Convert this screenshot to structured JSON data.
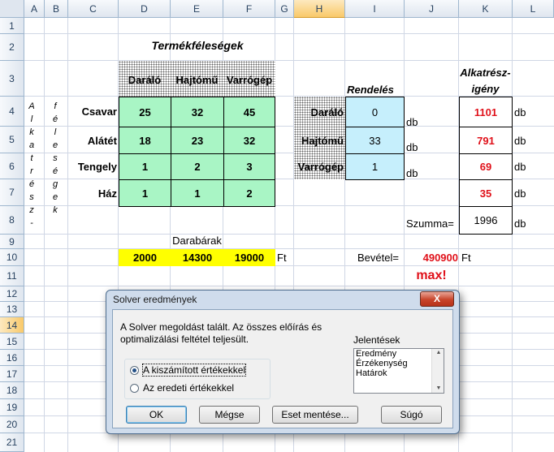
{
  "columns": [
    "A",
    "B",
    "C",
    "D",
    "E",
    "F",
    "G",
    "H",
    "I",
    "J",
    "K",
    "L"
  ],
  "rows": [
    "1",
    "2",
    "3",
    "4",
    "5",
    "6",
    "7",
    "8",
    "9",
    "10",
    "11",
    "12",
    "13",
    "14",
    "15",
    "16",
    "17",
    "18",
    "19",
    "20",
    "21"
  ],
  "sheet": {
    "title": "Termékféleségek",
    "header_products": [
      "Daráló",
      "Hajtómű",
      "Varrógép"
    ],
    "row_labels": [
      "Csavar",
      "Alátét",
      "Tengely",
      "Ház"
    ],
    "matrix": [
      [
        "25",
        "32",
        "45"
      ],
      [
        "18",
        "23",
        "32"
      ],
      [
        "1",
        "2",
        "3"
      ],
      [
        "1",
        "1",
        "2"
      ]
    ],
    "vertical_a": [
      "A",
      "l",
      "k",
      "a",
      "t",
      "r",
      "é",
      "s",
      "z",
      "-"
    ],
    "vertical_b": [
      "f",
      "é",
      "l",
      "e",
      "s",
      "é",
      "g",
      "e",
      "k"
    ],
    "order_title": "Rendelés",
    "order_labels": [
      "Daráló",
      "Hajtómű",
      "Varrógép"
    ],
    "order_values": [
      "0",
      "33",
      "1"
    ],
    "unit_db": "db",
    "need_title": "Alkatrész-igény",
    "need_values": [
      "1101",
      "791",
      "69",
      "35"
    ],
    "sum_label": "Szumma=",
    "sum_value": "1996",
    "price_label": "Darabárak",
    "prices": [
      "2000",
      "14300",
      "19000"
    ],
    "unit_ft": "Ft",
    "revenue_label": "Bevétel=",
    "revenue_value": "490900",
    "max_label": "max!"
  },
  "dialog": {
    "title": "Solver eredmények",
    "close": "X",
    "message": "A Solver megoldást talált. Az összes előírás és optimalizálási feltétel teljesült.",
    "reports_label": "Jelentések",
    "reports": [
      "Eredmény",
      "Érzékenység",
      "Határok"
    ],
    "radio_keep": "A kiszámított értékekkel",
    "radio_restore": "Az eredeti értékekkel",
    "btn_ok": "OK",
    "btn_cancel": "Mégse",
    "btn_save": "Eset mentése...",
    "btn_help": "Súgó"
  }
}
